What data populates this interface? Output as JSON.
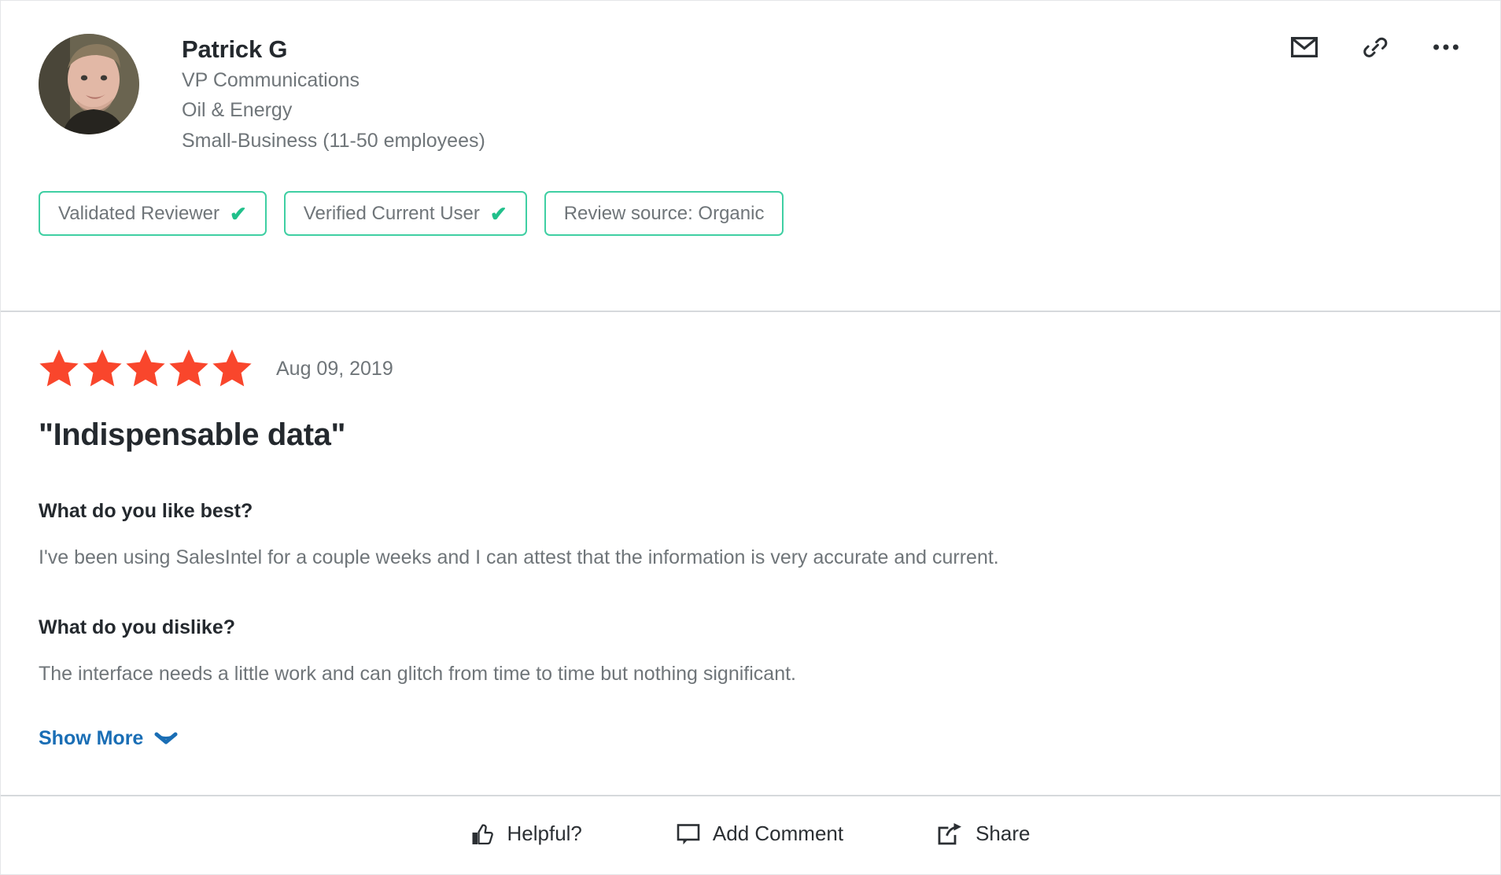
{
  "reviewer": {
    "name": "Patrick G",
    "title": "VP Communications",
    "industry": "Oil & Energy",
    "company_size": "Small-Business (11-50 employees)",
    "avatar_alt": "avatar"
  },
  "header_actions": [
    {
      "name": "mail-icon",
      "label": "Email"
    },
    {
      "name": "link-icon",
      "label": "Copy link"
    },
    {
      "name": "more-icon",
      "label": "More options"
    }
  ],
  "badges": [
    {
      "label": "Validated Reviewer",
      "check": "✔",
      "has_check": true
    },
    {
      "label": "Verified Current User",
      "check": "✔",
      "has_check": true
    },
    {
      "label": "Review source: Organic",
      "check": "",
      "has_check": false
    }
  ],
  "review": {
    "rating": 5,
    "max_rating": 5,
    "date": "Aug 09, 2019",
    "title": "\"Indispensable data\"",
    "sections": [
      {
        "question": "What do you like best?",
        "answer": "I've been using SalesIntel for a couple weeks and I can attest that the information is very accurate and current."
      },
      {
        "question": "What do you dislike?",
        "answer": "The interface needs a little work and can glitch from time to time but nothing significant."
      }
    ],
    "show_more_label": "Show More"
  },
  "footer_actions": [
    {
      "label": "Helpful?",
      "icon": "thumbs-up-icon"
    },
    {
      "label": "Add Comment",
      "icon": "comment-icon"
    },
    {
      "label": "Share",
      "icon": "share-icon"
    }
  ],
  "colors": {
    "star": "#f9462c",
    "badge_border": "#3fcfa3",
    "check": "#21c08b",
    "link": "#1a6eb5",
    "heading": "#24292e",
    "muted": "#6f7579",
    "divider": "#d6d9dc"
  }
}
